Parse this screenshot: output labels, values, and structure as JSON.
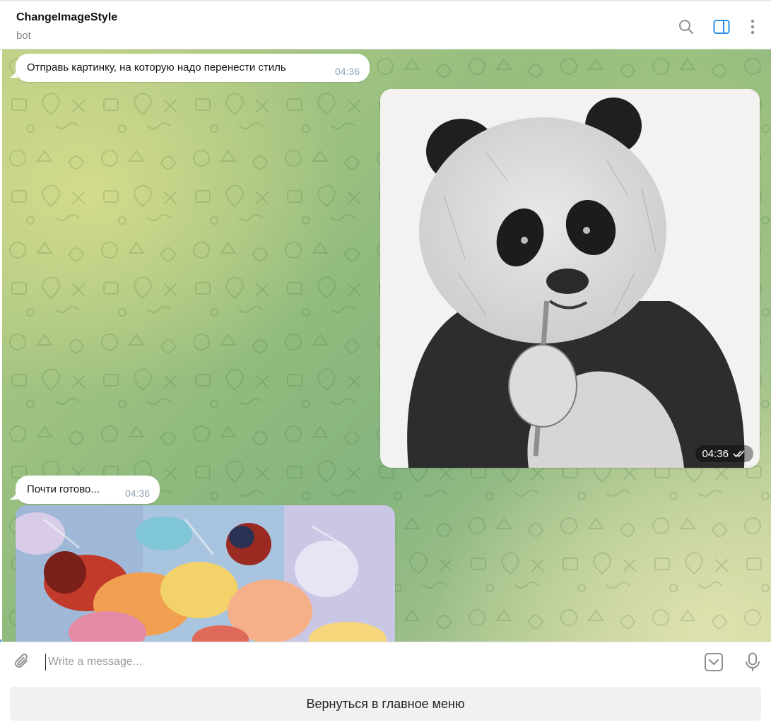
{
  "header": {
    "title": "ChangeImageStyle",
    "subtitle": "bot",
    "icons": [
      "search-icon",
      "sidebar-toggle-icon",
      "more-vertical-icon"
    ],
    "accent_color": "#2e8ee0"
  },
  "messages": [
    {
      "type": "text",
      "direction": "incoming",
      "text": "Отправь картинку, на которую надо перенести стиль",
      "time": "04:36"
    },
    {
      "type": "photo",
      "direction": "outgoing",
      "description_icon": "panda-sketch-image",
      "time": "04:36",
      "status": "read"
    },
    {
      "type": "text",
      "direction": "incoming",
      "text": "Почти готово...",
      "time": "04:36"
    },
    {
      "type": "photo",
      "direction": "incoming",
      "description_icon": "stylized-painting-image"
    }
  ],
  "composer": {
    "placeholder": "Write a message...",
    "icons": [
      "attach-icon",
      "bot-keyboard-icon",
      "microphone-icon"
    ]
  },
  "keyboard": {
    "button_label": "Вернуться в главное меню"
  }
}
